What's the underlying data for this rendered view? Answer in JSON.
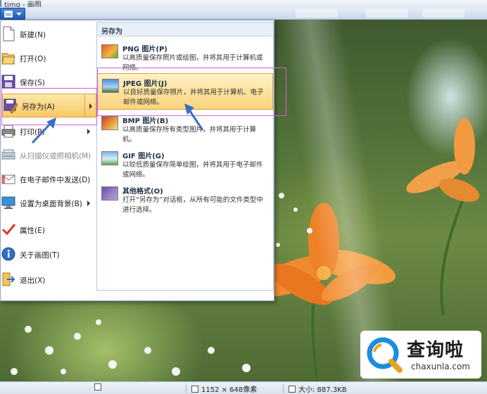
{
  "window": {
    "title": "timg - 画图"
  },
  "app_menu": {
    "items": [
      {
        "label": "新建(N)",
        "icon": "new-document-icon",
        "enabled": true
      },
      {
        "label": "打开(O)",
        "icon": "open-folder-icon",
        "enabled": true
      },
      {
        "label": "保存(S)",
        "icon": "save-disk-icon",
        "enabled": true
      },
      {
        "label": "另存为(A)",
        "icon": "save-as-icon",
        "enabled": true,
        "active": true,
        "submenu": true
      },
      {
        "label": "打印(P)",
        "icon": "printer-icon",
        "enabled": true,
        "submenu": true
      },
      {
        "label": "从扫描仪或照相机(M)",
        "icon": "scanner-icon",
        "enabled": false
      },
      {
        "label": "在电子邮件中发送(D)",
        "icon": "email-icon",
        "enabled": true
      },
      {
        "label": "设置为桌面背景(B)",
        "icon": "desktop-background-icon",
        "enabled": true,
        "submenu": true
      },
      {
        "label": "属性(E)",
        "icon": "checkmark-properties-icon",
        "enabled": true
      },
      {
        "label": "关于画图(T)",
        "icon": "info-icon",
        "enabled": true
      },
      {
        "label": "退出(X)",
        "icon": "exit-icon",
        "enabled": true
      }
    ],
    "submenu": {
      "title": "另存为",
      "items": [
        {
          "title": "PNG 图片(P)",
          "desc": "以高质量保存照片或绘图，并将其用于计算机或网络。",
          "icon": "png-image-icon"
        },
        {
          "title": "JPEG 图片(J)",
          "desc": "以良好质量保存照片，并将其用于计算机、电子邮件或网络。",
          "icon": "jpeg-image-icon",
          "active": true
        },
        {
          "title": "BMP 图片(B)",
          "desc": "以高质量保存所有类型图片，并将其用于计算机。",
          "icon": "bmp-image-icon"
        },
        {
          "title": "GIF 图片(G)",
          "desc": "以较低质量保存简单绘图，并将其用于电子邮件或网络。",
          "icon": "gif-image-icon"
        },
        {
          "title": "其他格式(O)",
          "desc": "打开“另存为”对话框，从所有可能的文件类型中进行选择。",
          "icon": "other-formats-icon"
        }
      ]
    }
  },
  "status_bar": {
    "dimensions": "1152 × 648像素",
    "size": "大小: 887.3KB"
  },
  "watermark": {
    "cn": "查询啦",
    "en": "chaxunla.com"
  },
  "colors": {
    "highlight": "#f8c96a",
    "annotation": "#d062d8",
    "arrow": "#3b6fc4"
  }
}
